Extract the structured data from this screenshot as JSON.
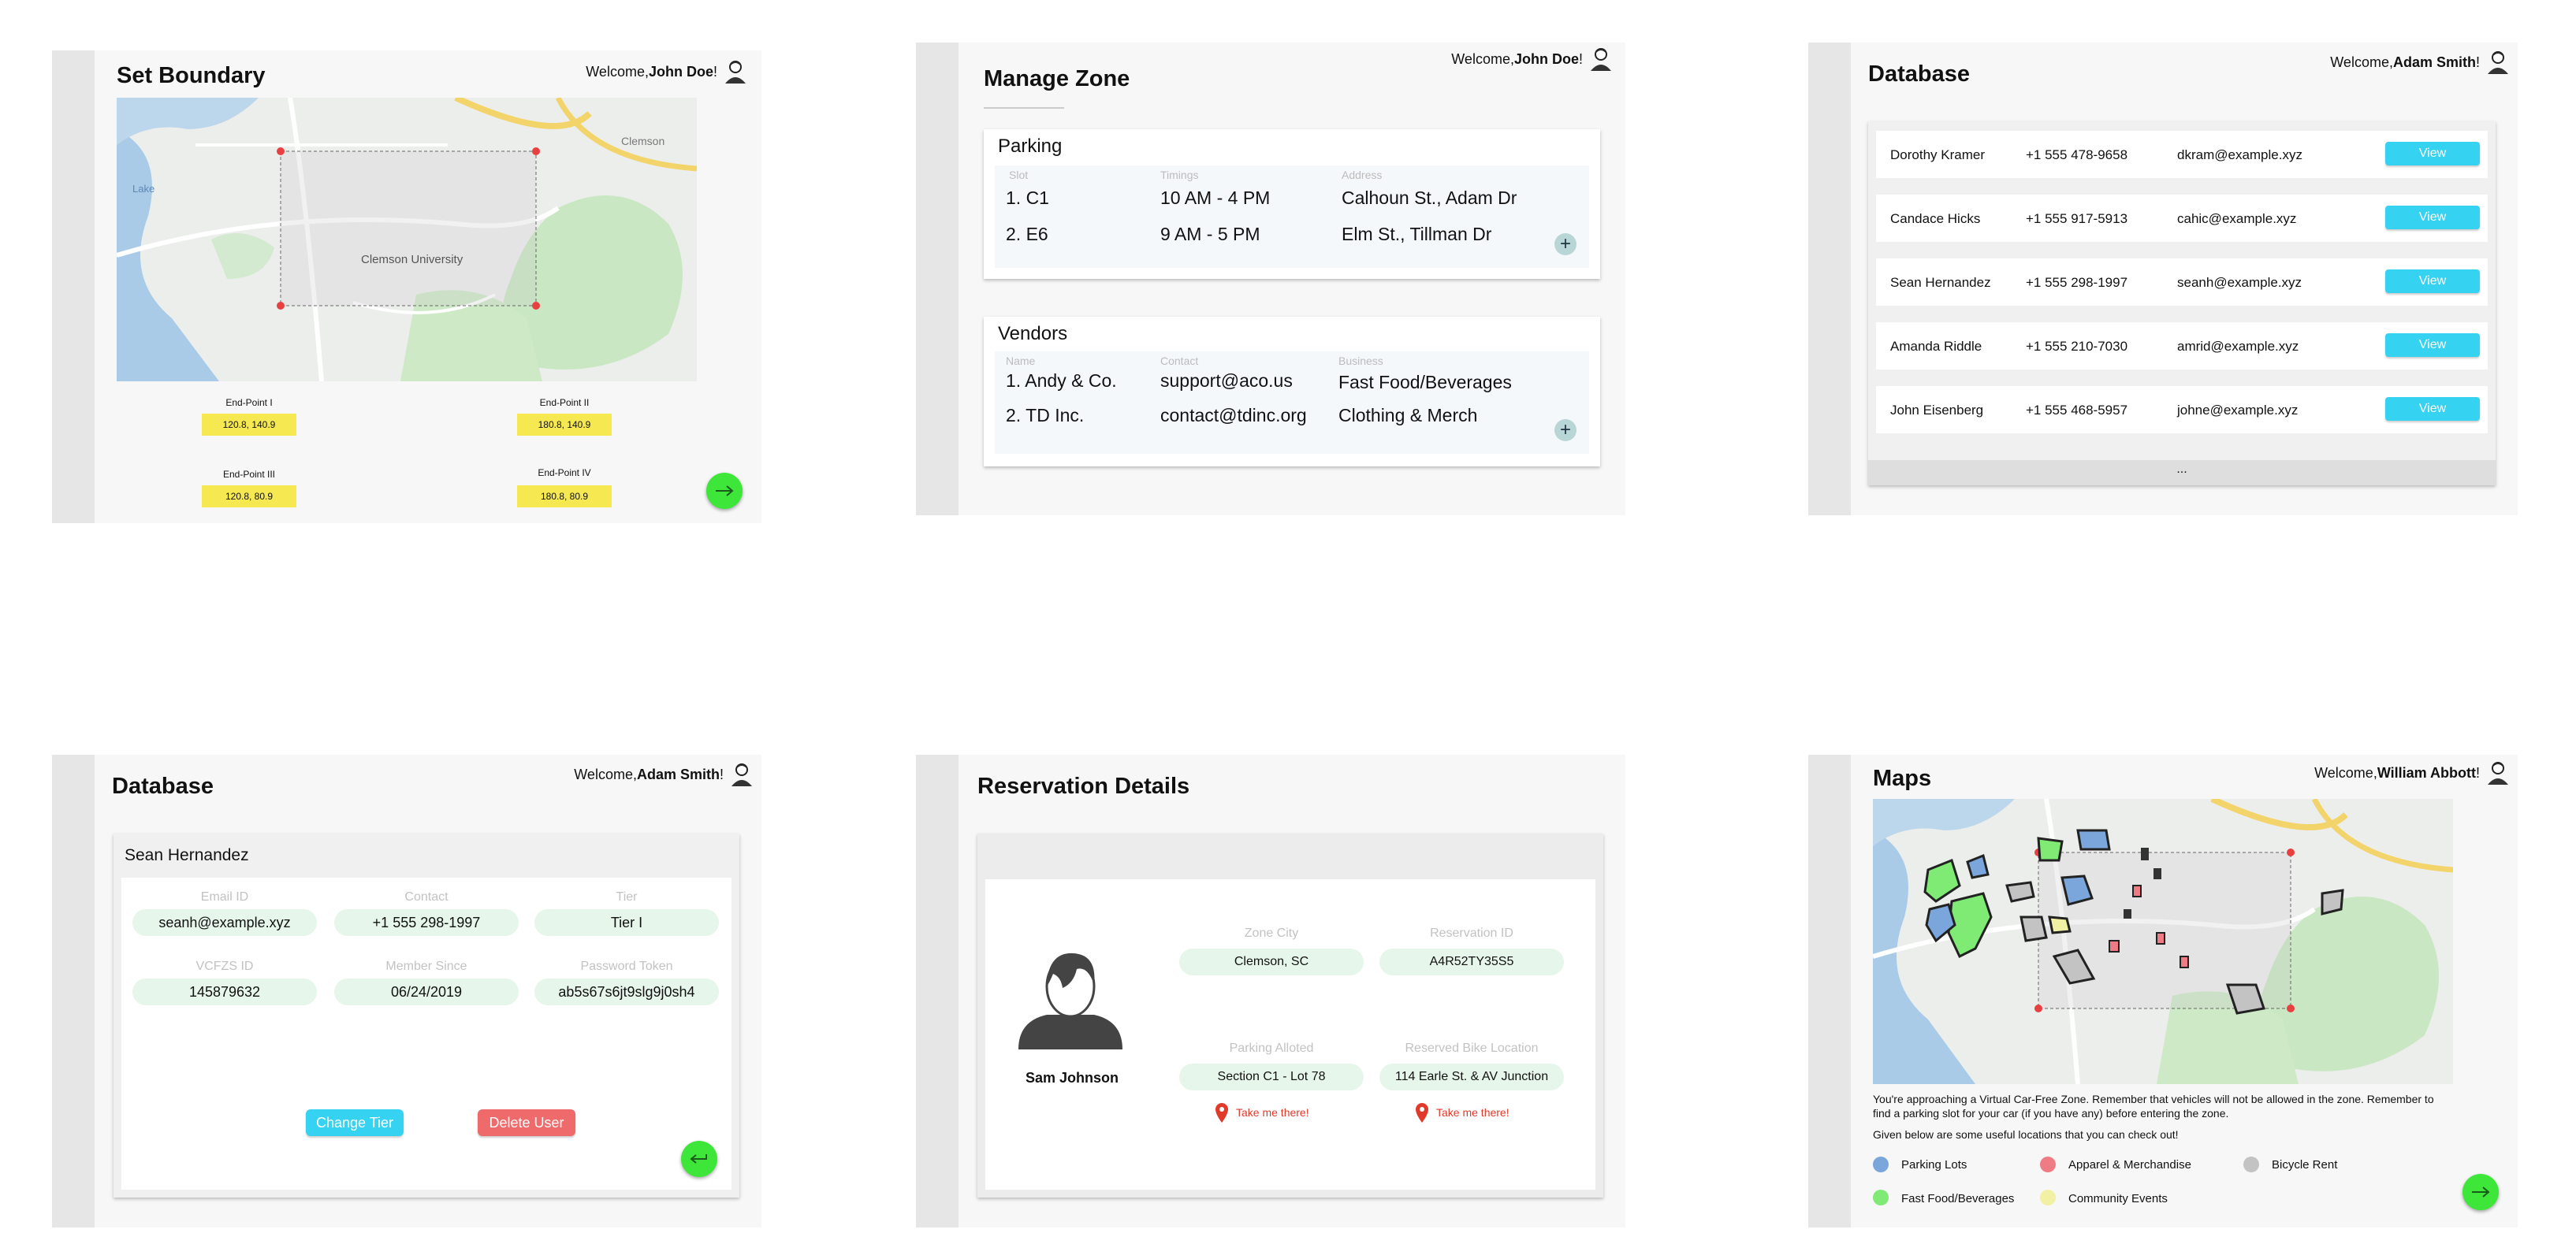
{
  "colors": {
    "accent_green": "#3ee63a",
    "view_blue": "#36d2f2",
    "delete_red": "#ef6b6b",
    "yellow": "#f5e851",
    "pill_green": "#e7f6ea"
  },
  "set_boundary": {
    "title": "Set Boundary",
    "welcome_prefix": "Welcome, ",
    "user": "John Doe",
    "welcome_suffix": "!",
    "endpoints": [
      {
        "label": "End-Point I",
        "value": "120.8, 140.9"
      },
      {
        "label": "End-Point II",
        "value": "180.8, 140.9"
      },
      {
        "label": "End-Point III",
        "value": "120.8, 80.9"
      },
      {
        "label": "End-Point IV",
        "value": "180.8, 80.9"
      }
    ],
    "map_labels": {
      "campus": "Clemson University",
      "area": "Clemson",
      "lake": "Lake"
    },
    "next_icon": "arrow-right-icon"
  },
  "manage_zone": {
    "title": "Manage Zone",
    "welcome_prefix": "Welcome, ",
    "user": "John Doe",
    "welcome_suffix": "!",
    "parking": {
      "heading": "Parking",
      "col_slot": "Slot",
      "col_timings": "Timings",
      "col_address": "Address",
      "rows": [
        {
          "slot": "1. C1",
          "timings": "10 AM - 4 PM",
          "address": "Calhoun St., Adam Dr"
        },
        {
          "slot": "2. E6",
          "timings": "9 AM - 5 PM",
          "address": "Elm St., Tillman Dr"
        }
      ]
    },
    "vendors": {
      "heading": "Vendors",
      "col_name": "Name",
      "col_contact": "Contact",
      "col_business": "Business",
      "rows": [
        {
          "name": "1. Andy & Co.",
          "contact": "support@aco.us",
          "business": "Fast Food/Beverages"
        },
        {
          "name": "2. TD Inc.",
          "contact": "contact@tdinc.org",
          "business": "Clothing & Merch"
        }
      ]
    },
    "plus": "+"
  },
  "database_list": {
    "title": "Database",
    "welcome_prefix": "Welcome, ",
    "user": "Adam Smith",
    "welcome_suffix": "!",
    "rows": [
      {
        "name": "Dorothy Kramer",
        "phone": "+1 555 478-9658",
        "email": "dkram@example.xyz"
      },
      {
        "name": "Candace Hicks",
        "phone": "+1 555 917-5913",
        "email": "cahic@example.xyz"
      },
      {
        "name": "Sean Hernandez",
        "phone": "+1 555 298-1997",
        "email": "seanh@example.xyz"
      },
      {
        "name": "Amanda Riddle",
        "phone": "+1 555 210-7030",
        "email": "amrid@example.xyz"
      },
      {
        "name": "John Eisenberg",
        "phone": "+1 555 468-5957",
        "email": "johne@example.xyz"
      }
    ],
    "view_label": "View",
    "more": "..."
  },
  "database_detail": {
    "title": "Database",
    "welcome_prefix": "Welcome, ",
    "user": "Adam Smith",
    "welcome_suffix": "!",
    "name": "Sean Hernandez",
    "fields": [
      {
        "label": "Email ID",
        "value": "seanh@example.xyz"
      },
      {
        "label": "Contact",
        "value": "+1 555 298-1997"
      },
      {
        "label": "Tier",
        "value": "Tier I"
      },
      {
        "label": "VCFZS ID",
        "value": "145879632"
      },
      {
        "label": "Member Since",
        "value": "06/24/2019"
      },
      {
        "label": "Password Token",
        "value": "ab5s67s6jt9slg9j0sh4"
      }
    ],
    "change_tier": "Change Tier",
    "delete_user": "Delete User"
  },
  "reservation": {
    "title": "Reservation Details",
    "person": "Sam Johnson",
    "fields": [
      {
        "label": "Zone City",
        "value": "Clemson, SC"
      },
      {
        "label": "Reservation ID",
        "value": "A4R52TY35S5"
      },
      {
        "label": "Parking Alloted",
        "value": "Section C1 - Lot 78"
      },
      {
        "label": "Reserved Bike Location",
        "value": "114 Earle St. & AV Junction"
      }
    ],
    "take_me": "Take me there!"
  },
  "maps": {
    "title": "Maps",
    "welcome_prefix": "Welcome, ",
    "user": "William Abbott",
    "welcome_suffix": "!",
    "notice": "You're approaching a Virtual Car-Free Zone. Remember that vehicles will not be allowed in the zone. Remember to find a parking slot for your car (if you have any) before entering the zone.",
    "subnotice": "Given below are some useful locations that you can check out!",
    "legend": [
      {
        "label": "Parking Lots",
        "color": "#7aa6dc"
      },
      {
        "label": "Apparel & Merchandise",
        "color": "#ef7c85"
      },
      {
        "label": "Bicycle Rent",
        "color": "#c3c3c3"
      },
      {
        "label": "Fast Food/Beverages",
        "color": "#7fea74"
      },
      {
        "label": "Community Events",
        "color": "#f2f0a3"
      }
    ]
  }
}
